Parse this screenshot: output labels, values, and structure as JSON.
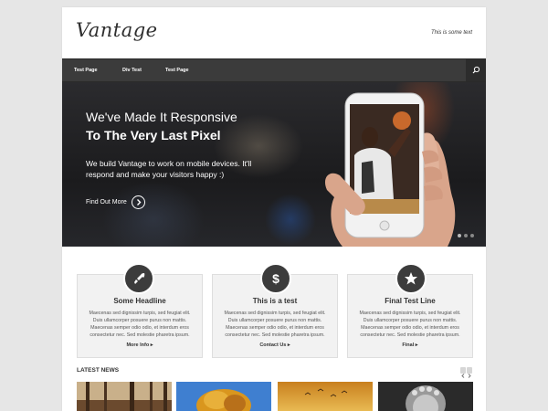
{
  "site": {
    "logo": "Vantage",
    "tagline": "This is some text"
  },
  "nav": {
    "items": [
      "Test Page",
      "Div Test",
      "Test Page"
    ]
  },
  "hero": {
    "title_line1": "We've Made It Responsive",
    "title_line2": "To The Very Last Pixel",
    "text_line1": "We build Vantage to work on mobile devices. It'll",
    "text_line2": "respond and make your visitors happy :)",
    "cta_label": "Find Out More"
  },
  "features": [
    {
      "icon": "rocket-icon",
      "title": "Some Headline",
      "lines": [
        "Maecenas sed dignissim turpis, sed feugiat elit.",
        "Duis ullamcorper posuere purus non mattis.",
        "Maecenas semper odio odio, et interdum eros",
        "consectetur nec. Sed molestie pharetra ipsum."
      ],
      "link": "More Info"
    },
    {
      "icon": "dollar-icon",
      "title": "This is a test",
      "lines": [
        "Maecenas sed dignissim turpis, sed feugiat elit.",
        "Duis ullamcorper posuere purus non mattis.",
        "Maecenas semper odio odio, et interdum eros",
        "consectetur nec. Sed molestie pharetra ipsum."
      ],
      "link": "Contact Us"
    },
    {
      "icon": "star-icon",
      "title": "Final Test Line",
      "lines": [
        "Maecenas sed dignissim turpis, sed feugiat elit.",
        "Duis ullamcorper posuere purus non mattis.",
        "Maecenas semper odio odio, et interdum eros",
        "consectetur nec. Sed molestie pharetra ipsum."
      ],
      "link": "Final"
    }
  ],
  "news": {
    "title": "LATEST NEWS"
  },
  "colors": {
    "nav_bg": "#3b3b3b",
    "feature_icon_bg": "#3c3c3c",
    "page_bg": "#e6e6e6"
  }
}
